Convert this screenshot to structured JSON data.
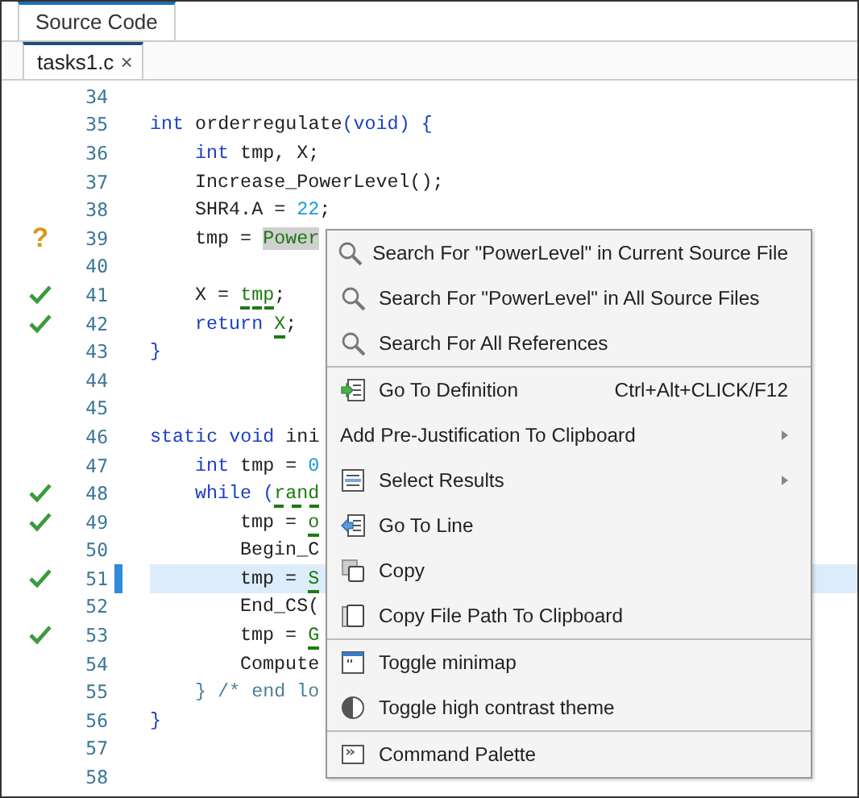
{
  "panel_tab": {
    "label": "Source Code",
    "selected": true
  },
  "file_tabs": [
    {
      "label": "tasks1.c",
      "close": "×",
      "selected": true
    }
  ],
  "lines": [
    {
      "num": "34",
      "verified": false,
      "selected": false
    },
    {
      "num": "35",
      "verified": false,
      "selected": false,
      "code": [
        {
          "kind": "keyword",
          "text": "int"
        },
        {
          "text": " orderregulate"
        },
        {
          "kind": "keyword",
          "text": "(void) {"
        }
      ],
      "children": [
        {
          "num": "36",
          "verified": false,
          "selected": false,
          "code": [
            {
              "kind": "keyword",
              "text": "int"
            },
            {
              "text": " tmp, X;"
            }
          ]
        },
        {
          "num": "37",
          "verified": false,
          "selected": false,
          "code": [
            {
              "text": "Increase_PowerLevel();"
            }
          ]
        },
        {
          "num": "38",
          "verified": false,
          "selected": false,
          "code": [
            {
              "text": "SHR4.A = "
            },
            {
              "kind": "number",
              "text": "22"
            },
            {
              "text": ";"
            }
          ]
        },
        {
          "num": "39",
          "flag": "?",
          "verified": false,
          "selected": false,
          "code": [
            {
              "text": "tmp = "
            },
            {
              "kind": "highlight",
              "text": "Power"
            }
          ]
        },
        {
          "num": "40",
          "verified": false,
          "selected": false
        },
        {
          "num": "41",
          "verified": true,
          "selected": false,
          "code": [
            {
              "text": "X = "
            },
            {
              "kind": "variable",
              "text": "tmp"
            },
            {
              "text": ";"
            }
          ]
        },
        {
          "num": "42",
          "verified": true,
          "selected": false,
          "code": [
            {
              "kind": "keyword",
              "text": "return "
            },
            {
              "kind": "variable",
              "text": "X"
            },
            {
              "text": ";"
            }
          ]
        }
      ]
    },
    {
      "num": "43",
      "verified": false,
      "selected": false,
      "code": [
        {
          "kind": "keyword",
          "text": "}"
        }
      ]
    },
    {
      "num": "44",
      "verified": false,
      "selected": false
    },
    {
      "num": "45",
      "verified": false,
      "selected": false
    },
    {
      "num": "46",
      "verified": false,
      "selected": false,
      "code": [
        {
          "kind": "keyword",
          "text": "static void"
        },
        {
          "text": " ini"
        }
      ],
      "children": [
        {
          "num": "47",
          "verified": false,
          "selected": false,
          "code": [
            {
              "kind": "keyword",
              "text": "int"
            },
            {
              "text": " tmp = "
            },
            {
              "kind": "number",
              "text": "0"
            }
          ]
        },
        {
          "num": "48",
          "verified": true,
          "selected": false,
          "code": [
            {
              "kind": "keyword",
              "text": "while ("
            },
            {
              "kind": "variable",
              "text": "rand"
            }
          ],
          "children": [
            {
              "num": "49",
              "verified": true,
              "selected": false,
              "code": [
                {
                  "text": "tmp = "
                },
                {
                  "kind": "variable",
                  "text": "o"
                }
              ]
            },
            {
              "num": "50",
              "verified": false,
              "selected": false,
              "code": [
                {
                  "text": "Begin_C"
                }
              ]
            },
            {
              "num": "51",
              "verified": true,
              "selected": true,
              "code": [
                {
                  "text": "tmp = "
                },
                {
                  "kind": "variable",
                  "text": "S"
                }
              ]
            },
            {
              "num": "52",
              "verified": false,
              "selected": false,
              "code": [
                {
                  "text": "End_CS("
                }
              ]
            },
            {
              "num": "53",
              "verified": true,
              "selected": false,
              "code": [
                {
                  "text": "tmp = "
                },
                {
                  "kind": "variable",
                  "text": "G"
                }
              ]
            },
            {
              "num": "54",
              "verified": false,
              "selected": false,
              "code": [
                {
                  "text": "Compute"
                }
              ]
            }
          ]
        },
        {
          "num": "55",
          "verified": false,
          "selected": false,
          "code": [
            {
              "kind": "comment",
              "text": "} /* end lo"
            }
          ]
        }
      ]
    },
    {
      "num": "56",
      "verified": false,
      "selected": false,
      "code": [
        {
          "kind": "keyword",
          "text": "}"
        }
      ]
    },
    {
      "num": "57",
      "verified": false,
      "selected": false
    },
    {
      "num": "58",
      "verified": false,
      "selected": false
    }
  ],
  "context_menu": [
    [
      {
        "kind": "search",
        "label": "Search For \"PowerLevel\" in Current Source File"
      },
      {
        "kind": "search",
        "label": "Search For \"PowerLevel\" in All Source Files"
      },
      {
        "kind": "search",
        "label": "Search For All References"
      }
    ],
    [
      {
        "kind": "goto",
        "label": "Go To Definition",
        "shortcut": "Ctrl+Alt+CLICK/F12"
      },
      {
        "kind": "plain",
        "label": "Add Pre-Justification To Clipboard",
        "submenu": true
      },
      {
        "kind": "select",
        "label": "Select Results",
        "submenu": true
      },
      {
        "kind": "gotoline",
        "label": "Go To Line"
      },
      {
        "kind": "copy",
        "label": "Copy"
      },
      {
        "kind": "copyfile",
        "label": "Copy File Path To Clipboard"
      }
    ],
    [
      {
        "kind": "minimap",
        "label": "Toggle minimap"
      },
      {
        "kind": "contrast",
        "label": "Toggle high contrast theme"
      }
    ],
    [
      {
        "kind": "palette",
        "label": "Command Palette"
      }
    ]
  ]
}
